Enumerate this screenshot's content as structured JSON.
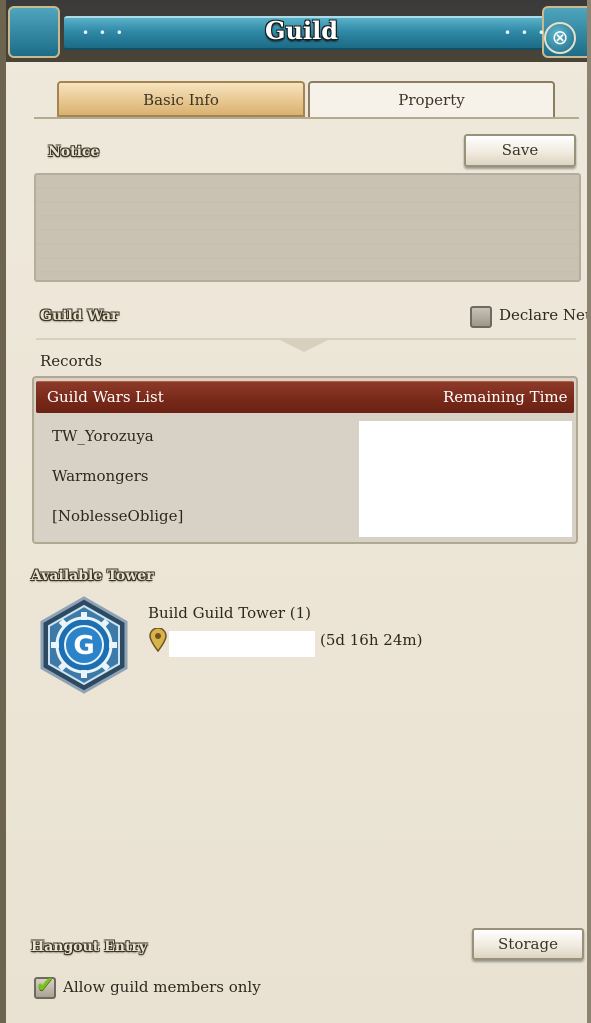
{
  "window": {
    "title": "Guild",
    "title_ornament_left": "• • •",
    "title_ornament_right": "• • •",
    "close_glyph": "⊗"
  },
  "tabs": [
    {
      "label": "Basic Info",
      "active": false
    },
    {
      "label": "Property",
      "active": true
    }
  ],
  "notice": {
    "label": "Notice",
    "save_label": "Save",
    "text": ""
  },
  "guild_war": {
    "label": "Guild War",
    "declare_neutral_label": "Declare Neutr",
    "declare_neutral_checked": false
  },
  "records": {
    "label": "Records",
    "columns": [
      "Guild Wars List",
      "Remaining Time"
    ],
    "rows": [
      {
        "guild": "TW_Yorozuya",
        "remaining": ""
      },
      {
        "guild": "Warmongers",
        "remaining": ""
      },
      {
        "guild": "[NoblesseOblige]",
        "remaining": ""
      }
    ]
  },
  "tower": {
    "label": "Available Tower",
    "item_name": "Build Guild Tower (1)",
    "location": "",
    "duration": "(5d 16h 24m)",
    "icon": "guild-tower-emblem-icon",
    "pin_icon": "map-pin-icon"
  },
  "hangout": {
    "label": "Hangout Entry",
    "storage_label": "Storage",
    "members_only_label": "Allow guild members only",
    "members_only_checked": true
  },
  "colors": {
    "title_bar_accent": "#2f8aa6",
    "records_header": "#772818",
    "checkmark": "#79c21a",
    "panel_bg": "#ece5d6"
  }
}
